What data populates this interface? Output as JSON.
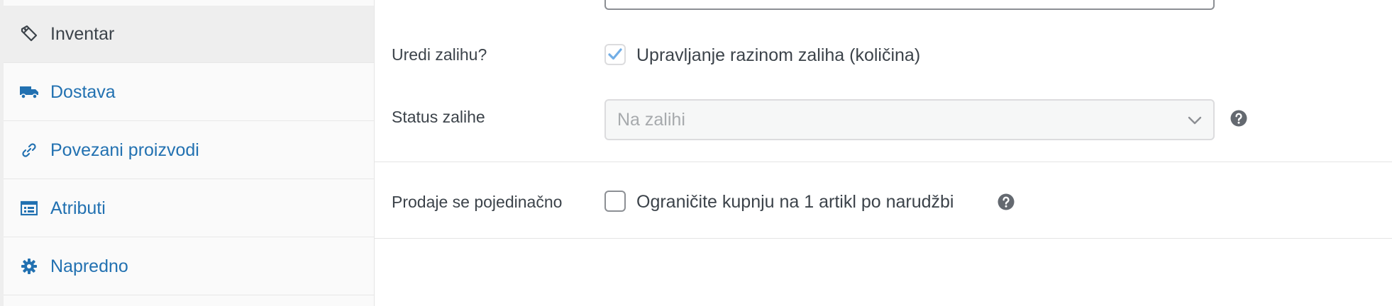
{
  "sidebar": {
    "items": [
      {
        "label": "Inventar",
        "icon": "tag-icon",
        "active": true
      },
      {
        "label": "Dostava",
        "icon": "truck-icon",
        "active": false
      },
      {
        "label": "Povezani proizvodi",
        "icon": "link-icon",
        "active": false
      },
      {
        "label": "Atributi",
        "icon": "list-view-icon",
        "active": false
      },
      {
        "label": "Napredno",
        "icon": "gear-icon",
        "active": false
      }
    ]
  },
  "inventory": {
    "manage_stock": {
      "label": "Uredi zalihu?",
      "checkbox_label": "Upravljanje razinom zaliha (količina)",
      "checked": true
    },
    "stock_status": {
      "label": "Status zalihe",
      "selected": "Na zalihi"
    },
    "sold_individually": {
      "label": "Prodaje se pojedinačno",
      "checkbox_label": "Ograničite kupnju na 1 artikl po narudžbi",
      "checked": false
    }
  },
  "colors": {
    "link": "#2271b1",
    "text": "#3c434a",
    "check": "#72aee6",
    "help": "#646970"
  }
}
